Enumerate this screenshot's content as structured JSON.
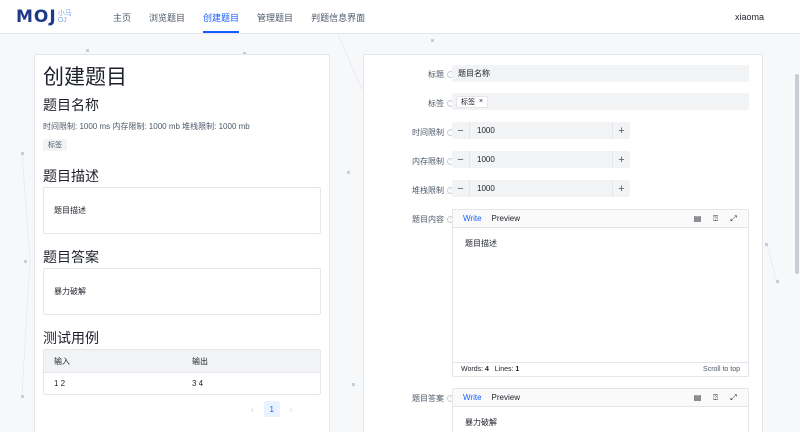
{
  "header": {
    "logo_main": "MOJ",
    "logo_sub_top": "小马",
    "logo_sub_bottom": "OJ",
    "nav": [
      {
        "label": "主页",
        "active": false
      },
      {
        "label": "浏览题目",
        "active": false
      },
      {
        "label": "创建题目",
        "active": true
      },
      {
        "label": "管理题目",
        "active": false
      },
      {
        "label": "判题信息界面",
        "active": false
      }
    ],
    "user": "xiaoma"
  },
  "preview": {
    "page_title": "创建题目",
    "question_title": "题目名称",
    "limits": "时间限制: 1000 ms 内存限制: 1000 mb 堆栈限制: 1000 mb",
    "tag": "标签",
    "desc_heading": "题目描述",
    "desc_text": "题目描述",
    "answer_heading": "题目答案",
    "answer_text": "暴力破解",
    "cases_heading": "测试用例",
    "table": {
      "headers": [
        "输入",
        "输出"
      ],
      "rows": [
        [
          "1 2",
          "3 4"
        ]
      ]
    },
    "pager": {
      "prev": "‹",
      "page": "1",
      "next": "›"
    }
  },
  "form": {
    "title_label": "标题",
    "title_value": "题目名称",
    "tags_label": "标签",
    "tag_chip": "标签",
    "time_label": "时间限制",
    "time_value": "1000",
    "memory_label": "内存限制",
    "memory_value": "1000",
    "stack_label": "堆栈限制",
    "stack_value": "1000",
    "content_label": "题目内容",
    "answer_label": "题目答案",
    "editor_content": {
      "write": "Write",
      "preview": "Preview",
      "body": "题目描述",
      "words_label": "Words:",
      "words": "4",
      "lines_label": "Lines:",
      "lines": "1",
      "scroll_top": "Scroll to top"
    },
    "editor_answer": {
      "write": "Write",
      "preview": "Preview",
      "body": "暴力破解"
    },
    "minus": "−",
    "plus": "+",
    "help": "?",
    "tag_close": "×"
  }
}
